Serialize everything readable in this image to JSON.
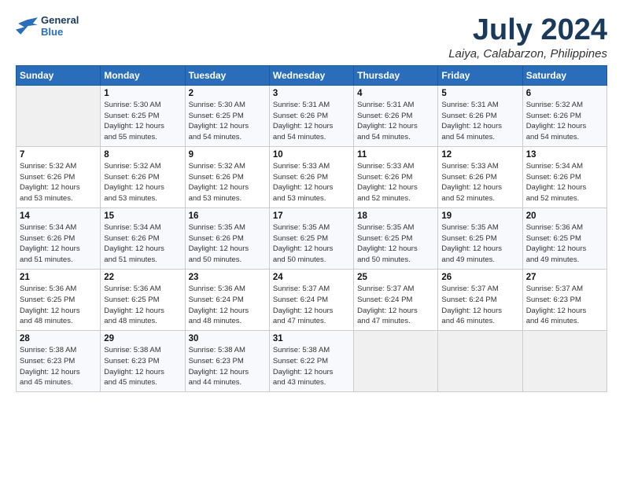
{
  "header": {
    "logo_line1": "General",
    "logo_line2": "Blue",
    "title": "July 2024",
    "subtitle": "Laiya, Calabarzon, Philippines"
  },
  "days_of_week": [
    "Sunday",
    "Monday",
    "Tuesday",
    "Wednesday",
    "Thursday",
    "Friday",
    "Saturday"
  ],
  "weeks": [
    [
      {
        "day": "",
        "info": ""
      },
      {
        "day": "1",
        "info": "Sunrise: 5:30 AM\nSunset: 6:25 PM\nDaylight: 12 hours\nand 55 minutes."
      },
      {
        "day": "2",
        "info": "Sunrise: 5:30 AM\nSunset: 6:25 PM\nDaylight: 12 hours\nand 54 minutes."
      },
      {
        "day": "3",
        "info": "Sunrise: 5:31 AM\nSunset: 6:26 PM\nDaylight: 12 hours\nand 54 minutes."
      },
      {
        "day": "4",
        "info": "Sunrise: 5:31 AM\nSunset: 6:26 PM\nDaylight: 12 hours\nand 54 minutes."
      },
      {
        "day": "5",
        "info": "Sunrise: 5:31 AM\nSunset: 6:26 PM\nDaylight: 12 hours\nand 54 minutes."
      },
      {
        "day": "6",
        "info": "Sunrise: 5:32 AM\nSunset: 6:26 PM\nDaylight: 12 hours\nand 54 minutes."
      }
    ],
    [
      {
        "day": "7",
        "info": "Sunrise: 5:32 AM\nSunset: 6:26 PM\nDaylight: 12 hours\nand 53 minutes."
      },
      {
        "day": "8",
        "info": "Sunrise: 5:32 AM\nSunset: 6:26 PM\nDaylight: 12 hours\nand 53 minutes."
      },
      {
        "day": "9",
        "info": "Sunrise: 5:32 AM\nSunset: 6:26 PM\nDaylight: 12 hours\nand 53 minutes."
      },
      {
        "day": "10",
        "info": "Sunrise: 5:33 AM\nSunset: 6:26 PM\nDaylight: 12 hours\nand 53 minutes."
      },
      {
        "day": "11",
        "info": "Sunrise: 5:33 AM\nSunset: 6:26 PM\nDaylight: 12 hours\nand 52 minutes."
      },
      {
        "day": "12",
        "info": "Sunrise: 5:33 AM\nSunset: 6:26 PM\nDaylight: 12 hours\nand 52 minutes."
      },
      {
        "day": "13",
        "info": "Sunrise: 5:34 AM\nSunset: 6:26 PM\nDaylight: 12 hours\nand 52 minutes."
      }
    ],
    [
      {
        "day": "14",
        "info": "Sunrise: 5:34 AM\nSunset: 6:26 PM\nDaylight: 12 hours\nand 51 minutes."
      },
      {
        "day": "15",
        "info": "Sunrise: 5:34 AM\nSunset: 6:26 PM\nDaylight: 12 hours\nand 51 minutes."
      },
      {
        "day": "16",
        "info": "Sunrise: 5:35 AM\nSunset: 6:26 PM\nDaylight: 12 hours\nand 50 minutes."
      },
      {
        "day": "17",
        "info": "Sunrise: 5:35 AM\nSunset: 6:25 PM\nDaylight: 12 hours\nand 50 minutes."
      },
      {
        "day": "18",
        "info": "Sunrise: 5:35 AM\nSunset: 6:25 PM\nDaylight: 12 hours\nand 50 minutes."
      },
      {
        "day": "19",
        "info": "Sunrise: 5:35 AM\nSunset: 6:25 PM\nDaylight: 12 hours\nand 49 minutes."
      },
      {
        "day": "20",
        "info": "Sunrise: 5:36 AM\nSunset: 6:25 PM\nDaylight: 12 hours\nand 49 minutes."
      }
    ],
    [
      {
        "day": "21",
        "info": "Sunrise: 5:36 AM\nSunset: 6:25 PM\nDaylight: 12 hours\nand 48 minutes."
      },
      {
        "day": "22",
        "info": "Sunrise: 5:36 AM\nSunset: 6:25 PM\nDaylight: 12 hours\nand 48 minutes."
      },
      {
        "day": "23",
        "info": "Sunrise: 5:36 AM\nSunset: 6:24 PM\nDaylight: 12 hours\nand 48 minutes."
      },
      {
        "day": "24",
        "info": "Sunrise: 5:37 AM\nSunset: 6:24 PM\nDaylight: 12 hours\nand 47 minutes."
      },
      {
        "day": "25",
        "info": "Sunrise: 5:37 AM\nSunset: 6:24 PM\nDaylight: 12 hours\nand 47 minutes."
      },
      {
        "day": "26",
        "info": "Sunrise: 5:37 AM\nSunset: 6:24 PM\nDaylight: 12 hours\nand 46 minutes."
      },
      {
        "day": "27",
        "info": "Sunrise: 5:37 AM\nSunset: 6:23 PM\nDaylight: 12 hours\nand 46 minutes."
      }
    ],
    [
      {
        "day": "28",
        "info": "Sunrise: 5:38 AM\nSunset: 6:23 PM\nDaylight: 12 hours\nand 45 minutes."
      },
      {
        "day": "29",
        "info": "Sunrise: 5:38 AM\nSunset: 6:23 PM\nDaylight: 12 hours\nand 45 minutes."
      },
      {
        "day": "30",
        "info": "Sunrise: 5:38 AM\nSunset: 6:23 PM\nDaylight: 12 hours\nand 44 minutes."
      },
      {
        "day": "31",
        "info": "Sunrise: 5:38 AM\nSunset: 6:22 PM\nDaylight: 12 hours\nand 43 minutes."
      },
      {
        "day": "",
        "info": ""
      },
      {
        "day": "",
        "info": ""
      },
      {
        "day": "",
        "info": ""
      }
    ]
  ]
}
